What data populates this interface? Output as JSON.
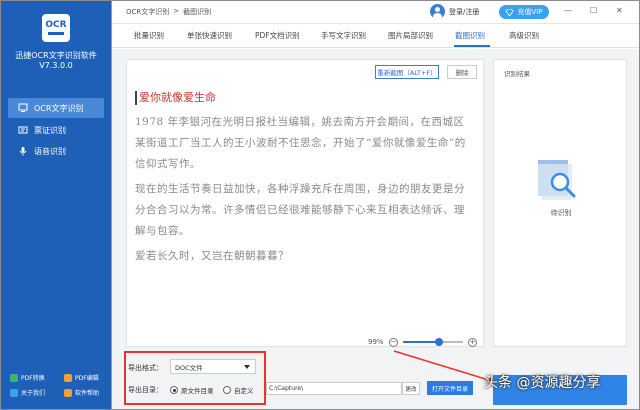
{
  "app": {
    "logo_text": "OCR",
    "name": "迅捷OCR文字识别软件",
    "version": "V7.3.0.0"
  },
  "sidebar": {
    "items": [
      {
        "label": "OCR文字识别",
        "icon": "monitor-icon",
        "active": true
      },
      {
        "label": "票证识别",
        "icon": "ticket-icon",
        "active": false
      },
      {
        "label": "语音识别",
        "icon": "microphone-icon",
        "active": false
      }
    ],
    "footer": [
      {
        "label": "PDF转换",
        "color": "#3cb371"
      },
      {
        "label": "PDF编辑",
        "color": "#f0a030"
      },
      {
        "label": "关于我们",
        "color": "#3aa0f0"
      },
      {
        "label": "软件帮助",
        "color": "#f0a030"
      }
    ]
  },
  "header": {
    "breadcrumb": [
      "OCR文字识别",
      ">",
      "截图识别"
    ],
    "login_label": "登录/注册",
    "vip_label": "充值VIP",
    "window_controls": [
      "—",
      "☐",
      "✕"
    ]
  },
  "tabs": [
    {
      "label": "批量识别",
      "active": false
    },
    {
      "label": "单张快速识别",
      "active": false
    },
    {
      "label": "PDF文档识别",
      "active": false
    },
    {
      "label": "手写文字识别",
      "active": false
    },
    {
      "label": "图片局部识别",
      "active": false
    },
    {
      "label": "截图识别",
      "active": true
    },
    {
      "label": "高级识别",
      "active": false
    }
  ],
  "document": {
    "rescan_label": "重新截图（ALT+F）",
    "delete_label": "删除",
    "title": "爱你就像爱生命",
    "paragraphs": [
      "1978 年李银河在光明日报社当编辑，姚去南方开会期间，在西城区某街道工厂当工人的王小波耐不住思念，开始了“爱你就像爱生命”的信仰式写作。",
      "现在的生活节奏日益加快，各种浮躁充斥在周围，身边的朋友更是分分合合习以为常。许多情侣已经很难能够静下心来互相表达倾诉、理解与包容。",
      "爱若长久时，又岂在朝朝暮暮？"
    ]
  },
  "result": {
    "title": "识别结果",
    "empty_label": "待识别"
  },
  "zoom": {
    "level_label": "99%",
    "minus": "−",
    "plus": "+",
    "fraction": 0.6
  },
  "export": {
    "format_label": "导出格式：",
    "format_value": "DOC文件",
    "dir_label": "导出目录：",
    "radio_source": "原文件目录",
    "radio_custom": "自定义",
    "path_value": "C:\\Capture\\",
    "change_label": "更改",
    "open_dir_label": "打开文件目录"
  },
  "watermark": "头条 @资源趣分享",
  "colors": {
    "sidebar": "#1e5fb8",
    "accent": "#2d6fcf",
    "highlight_box": "#e8342b",
    "arrow": "#e8342b",
    "title_red": "#c0392b"
  }
}
